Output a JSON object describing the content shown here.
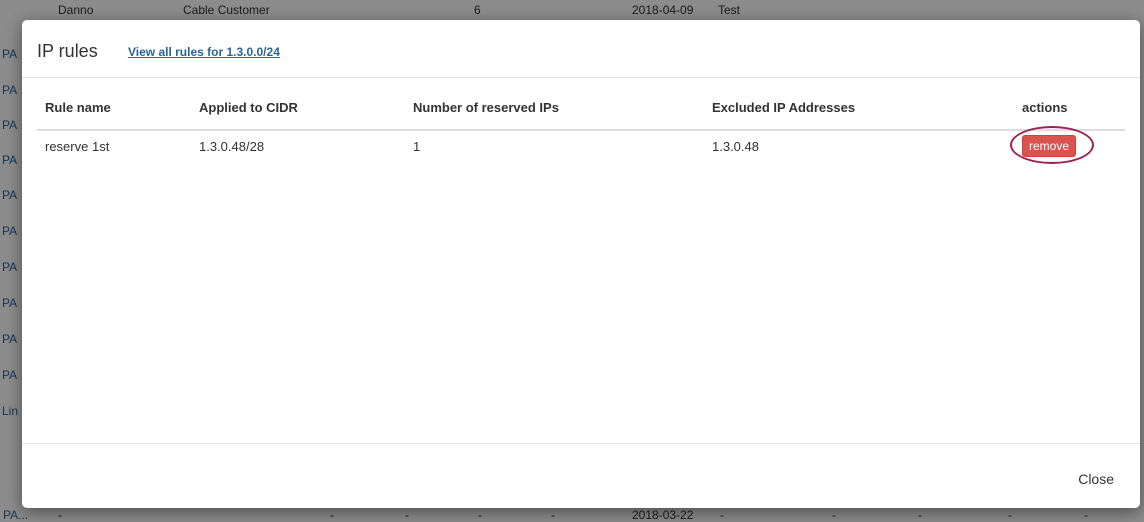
{
  "background": {
    "top_row": [
      "Danno",
      "Cable Customer",
      "6",
      "2018-04-09",
      "Test"
    ],
    "left_links": [
      "PA",
      "PA",
      "PA",
      "PA",
      "PA",
      "PA",
      "PA",
      "PA",
      "PA",
      "PA",
      "Lin"
    ],
    "bottom_row": {
      "link": "PA...",
      "dashes": [
        "-",
        "-",
        "-",
        "-",
        "-"
      ],
      "date": "2018-03-22",
      "dashes_after": [
        "-",
        "-",
        "-",
        "-",
        "-"
      ]
    }
  },
  "modal": {
    "title": "IP rules",
    "header_link": "View all rules for 1.3.0.0/24",
    "table": {
      "headers": [
        "Rule name",
        "Applied to CIDR",
        "Number of reserved IPs",
        "Excluded IP Addresses",
        "actions"
      ],
      "rows": [
        {
          "rule_name": "reserve 1st",
          "cidr": "1.3.0.48/28",
          "reserved": "1",
          "excluded": "1.3.0.48",
          "action_label": "remove"
        }
      ]
    },
    "footer": {
      "close_label": "Close"
    }
  },
  "colors": {
    "danger": "#d9534f",
    "highlight_ring": "#9b2452",
    "link": "#2a6496"
  }
}
